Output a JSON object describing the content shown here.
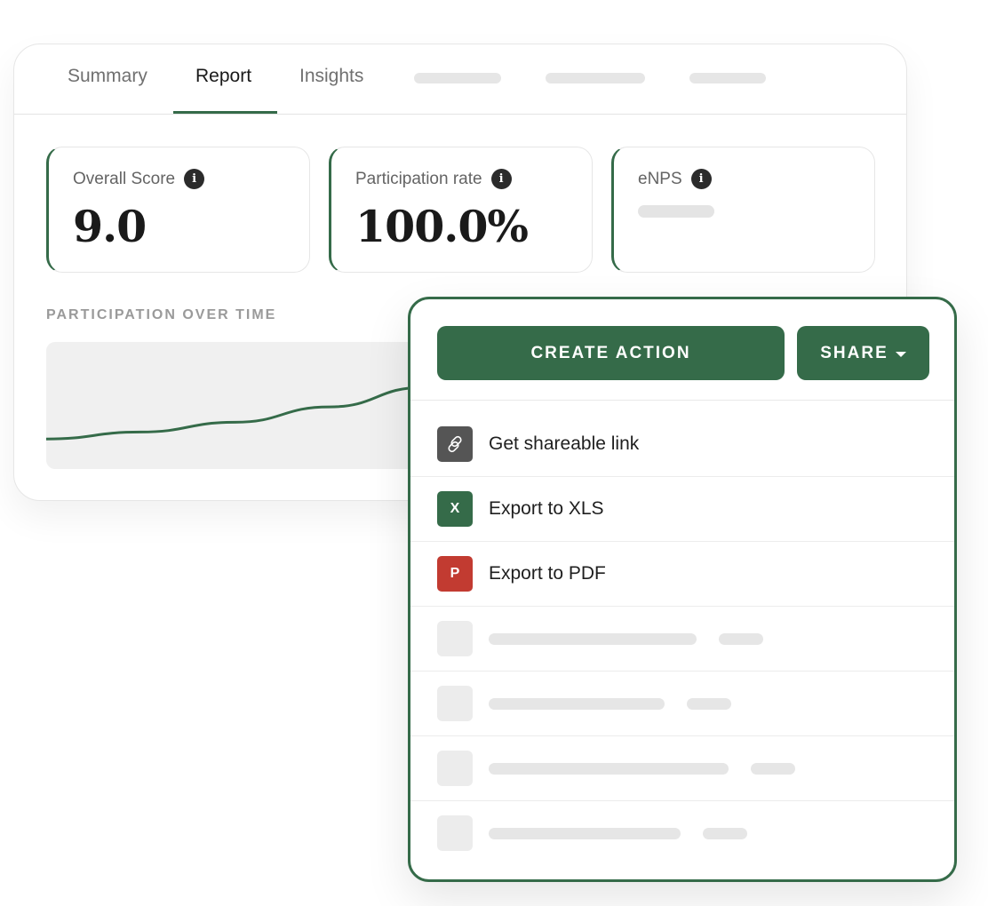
{
  "tabs": [
    {
      "label": "Summary",
      "active": false
    },
    {
      "label": "Report",
      "active": true
    },
    {
      "label": "Insights",
      "active": false
    }
  ],
  "stats": [
    {
      "label": "Overall Score",
      "value": "9.0"
    },
    {
      "label": "Participation rate",
      "value": "100.0%"
    },
    {
      "label": "eNPS",
      "value": null
    }
  ],
  "chart": {
    "title": "PARTICIPATION OVER TIME"
  },
  "chart_data": {
    "type": "line",
    "title": "PARTICIPATION OVER TIME",
    "series": [
      {
        "values": [
          10,
          15,
          22,
          33,
          47
        ]
      }
    ],
    "grid": false,
    "legend": "none"
  },
  "share_panel": {
    "create_action_label": "CREATE ACTION",
    "share_label": "SHARE",
    "items": [
      {
        "label": "Get shareable link",
        "icon": "link-icon",
        "icon_glyph": "🔗",
        "color": "#555555"
      },
      {
        "label": "Export to XLS",
        "icon": "xls-icon",
        "icon_glyph": "X",
        "color": "#356b49"
      },
      {
        "label": "Export to PDF",
        "icon": "pdf-icon",
        "icon_glyph": "P",
        "color": "#c23b31"
      }
    ]
  },
  "colors": {
    "accent": "#356b49",
    "pdf": "#c23b31",
    "link_icon_bg": "#555555"
  }
}
